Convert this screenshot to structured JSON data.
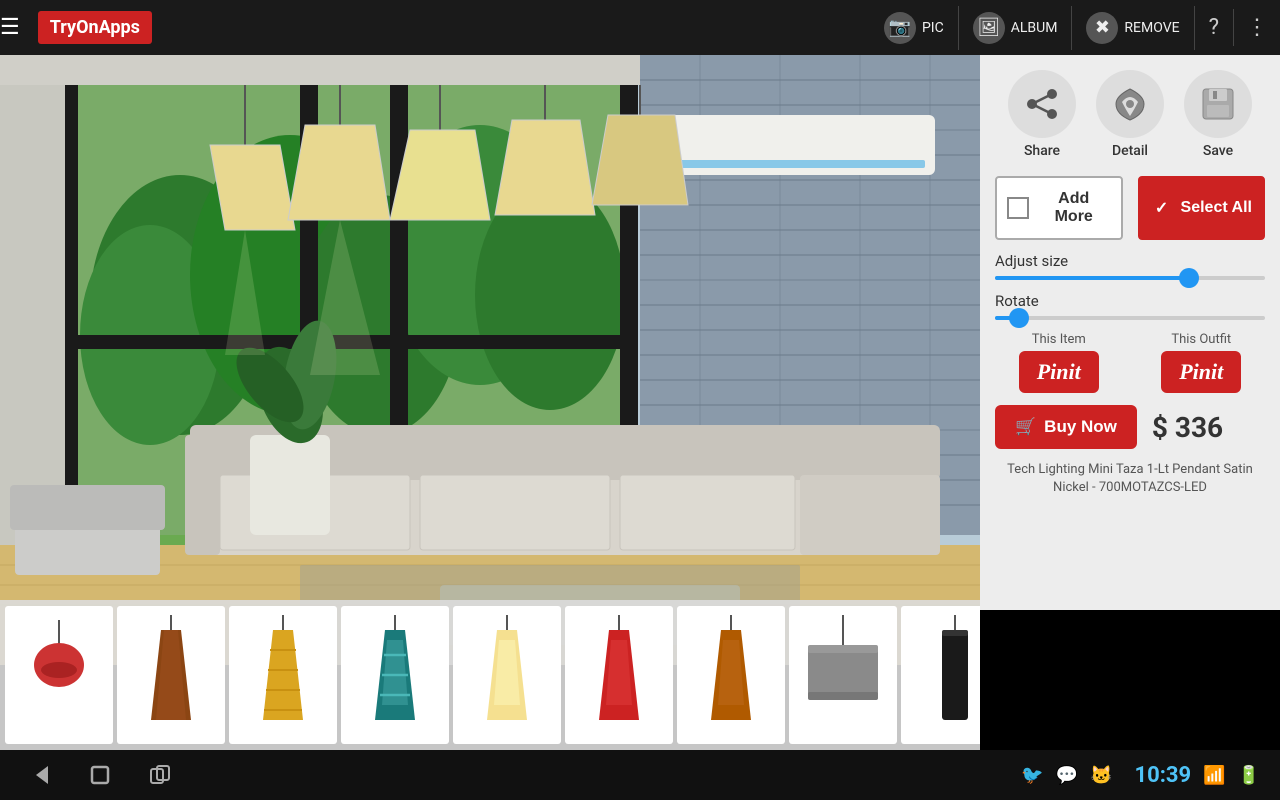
{
  "app": {
    "name": "TryOnApps"
  },
  "toolbar": {
    "pic_label": "PIC",
    "album_label": "ALBUM",
    "remove_label": "REMOVE",
    "help_icon": "?",
    "more_icon": "⋮"
  },
  "panel": {
    "share_label": "Share",
    "detail_label": "Detail",
    "save_label": "Save",
    "add_more_label": "Add More",
    "select_all_label": "Select All",
    "adjust_size_label": "Adjust size",
    "rotate_label": "Rotate",
    "this_item_label": "This Item",
    "this_outfit_label": "This Outfit",
    "pinit_label": "Pinit",
    "buy_now_label": "Buy Now",
    "price": "$ 336",
    "product_name": "Tech Lighting Mini Taza 1-Lt Pendant Satin Nickel - 700MOTAZCS-LED",
    "adjust_fill_width": "70%",
    "adjust_thumb_left": "68%",
    "rotate_thumb_left": "5%"
  },
  "status_bar": {
    "time": "10:39"
  },
  "thumbnails": [
    {
      "id": 1,
      "color": "#cc3333",
      "type": "round-small"
    },
    {
      "id": 2,
      "color": "#8B4513",
      "type": "tall-cone"
    },
    {
      "id": 3,
      "color": "#DAA520",
      "type": "tall-cone-striped"
    },
    {
      "id": 4,
      "color": "#1a8a8a",
      "type": "tall-cone-blue"
    },
    {
      "id": 5,
      "color": "#f5e090",
      "type": "tall-cone-light"
    },
    {
      "id": 6,
      "color": "#cc2222",
      "type": "tall-cone-red"
    },
    {
      "id": 7,
      "color": "#b05a00",
      "type": "tall-cone-amber"
    },
    {
      "id": 8,
      "color": "#888",
      "type": "drum"
    },
    {
      "id": 9,
      "color": "#222",
      "type": "cylinder-dark"
    }
  ]
}
